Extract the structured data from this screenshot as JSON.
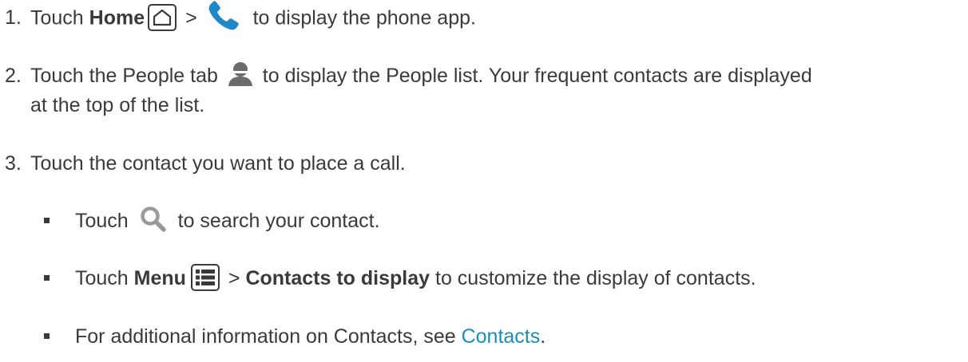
{
  "steps": [
    {
      "num": "1.",
      "pre": "Touch ",
      "bold": "Home",
      "mid": " > ",
      "post": " to display the phone app.",
      "icons": [
        "home-icon",
        "phone-icon"
      ]
    },
    {
      "num": "2.",
      "pre": "Touch the People tab ",
      "post": " to display the People list. Your frequent contacts are displayed",
      "post2": "at the top of the list.",
      "icons": [
        "person-icon"
      ]
    },
    {
      "num": "3.",
      "text": "Touch the contact you want to place a call."
    }
  ],
  "bullets": [
    {
      "pre": "Touch ",
      "post": " to search your contact.",
      "icons": [
        "search-icon"
      ]
    },
    {
      "pre": "Touch ",
      "bold1": "Menu",
      "mid": " > ",
      "bold2": "Contacts to display",
      "post": " to customize the display of contacts.",
      "icons": [
        "menu-icon"
      ]
    },
    {
      "pre": "For additional information on Contacts, see ",
      "link": "Contacts",
      "post": "."
    }
  ],
  "colors": {
    "text": "#3a3a3a",
    "link": "#1a8fb5",
    "phone_icon": "#1e88c8",
    "person_icon": "#6b6b6b",
    "search_icon": "#9a9a9a"
  }
}
